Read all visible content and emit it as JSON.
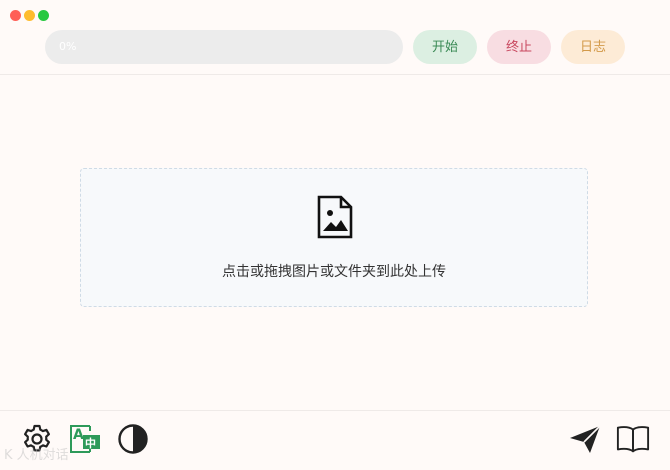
{
  "window": {
    "controls": [
      "close",
      "minimize",
      "maximize"
    ]
  },
  "toolbar": {
    "progress_percent": 0,
    "progress_text": "0%",
    "start_label": "开始",
    "stop_label": "终止",
    "log_label": "日志"
  },
  "dropzone": {
    "icon": "image-file-icon",
    "text": "点击或拖拽图片或文件夹到此处上传"
  },
  "bottom_bar": {
    "left_icons": [
      "gear-icon",
      "translate-icon",
      "contrast-icon"
    ],
    "right_icons": [
      "send-icon",
      "book-icon"
    ]
  },
  "watermark": {
    "text": "K 人机对话"
  },
  "colors": {
    "start_bg": "#dcefe2",
    "start_text": "#3a8a55",
    "stop_bg": "#f8dde2",
    "stop_text": "#c8475e",
    "log_bg": "#fdebd6",
    "log_text": "#d39a4a",
    "translate_accent": "#2e9a5a"
  }
}
